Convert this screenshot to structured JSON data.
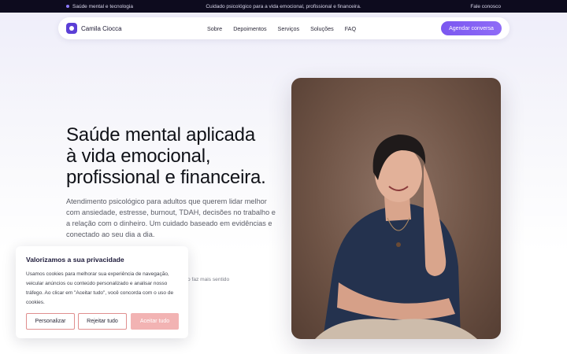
{
  "topbar": {
    "left_text": "Saúde mental e tecnologia",
    "center_text": "Cuidado psicológico para a vida emocional, profissional e financeira.",
    "right_link": "Fale conosco"
  },
  "nav": {
    "logo_text": "Camila Ciocca",
    "items": [
      "Sobre",
      "Depoimentos",
      "Serviços",
      "Soluções",
      "FAQ"
    ],
    "cta_label": "Agendar conversa"
  },
  "hero": {
    "headline": [
      "Saúde mental aplicada",
      "à vida emocional,",
      "profissional e financeira."
    ],
    "subtitle": "Atendimento psicológico para adultos que querem lidar melhor com ansiedade, estresse, burnout, TDAH, decisões no trabalho e a relação com o dinheiro. Um cuidado baseado em evidências e conectado ao seu dia a dia.",
    "partial_text": "o faz mais sentido"
  },
  "cookie": {
    "title": "Valorizamos a sua privacidade",
    "body": "Usamos cookies para melhorar sua experiência de navegação, veicular anúncios ou conteúdo personalizado e analisar nosso tráfego. Ao clicar em \"Aceitar tudo\", você concorda com o uso de cookies.",
    "customize_label": "Personalizar",
    "reject_label": "Rejeitar tudo",
    "accept_label": "Aceitar tudo"
  },
  "colors": {
    "accent": "#7b57f0",
    "topbar_bg": "#0d0b1e",
    "cookie_border": "#e08f8f"
  }
}
